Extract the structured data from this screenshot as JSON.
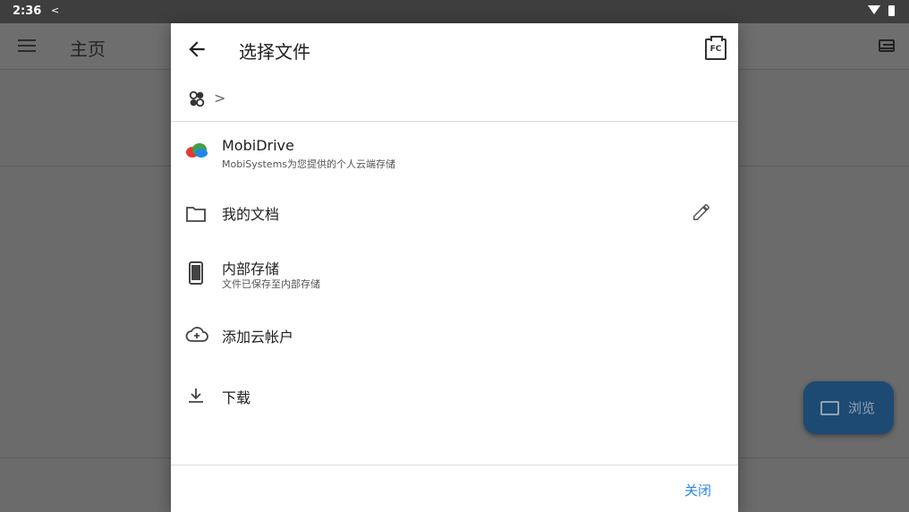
{
  "status_bar": {
    "time": "2:36",
    "share_glyph": "<",
    "icons": [
      "share-icon",
      "wifi-icon",
      "battery-icon"
    ]
  },
  "background_app": {
    "title": "主页",
    "fab_label": "浏览",
    "icons": [
      "menu-icon",
      "view-list-icon",
      "folder-icon"
    ],
    "fab_color": "#1d4a73"
  },
  "dialog": {
    "title": "选择文件",
    "breadcrumb_separator": ">",
    "items": [
      {
        "label": "MobiDrive",
        "subtitle": "MobiSystems为您提供的个人云端存储",
        "icon": "mobidrive-cloud-icon"
      },
      {
        "label": "我的文档",
        "icon": "folder-icon",
        "action_icon": "edit-pencil-icon"
      },
      {
        "label": "内部存储",
        "subtitle": "文件已保存至内部存储",
        "icon": "phone-icon"
      },
      {
        "label": "添加云帐户",
        "icon": "cloud-add-icon"
      },
      {
        "label": "下载",
        "icon": "download-icon"
      }
    ],
    "fc_icon_text": "FC",
    "close_label": "关闭",
    "accent_color": "#2a88d8"
  }
}
